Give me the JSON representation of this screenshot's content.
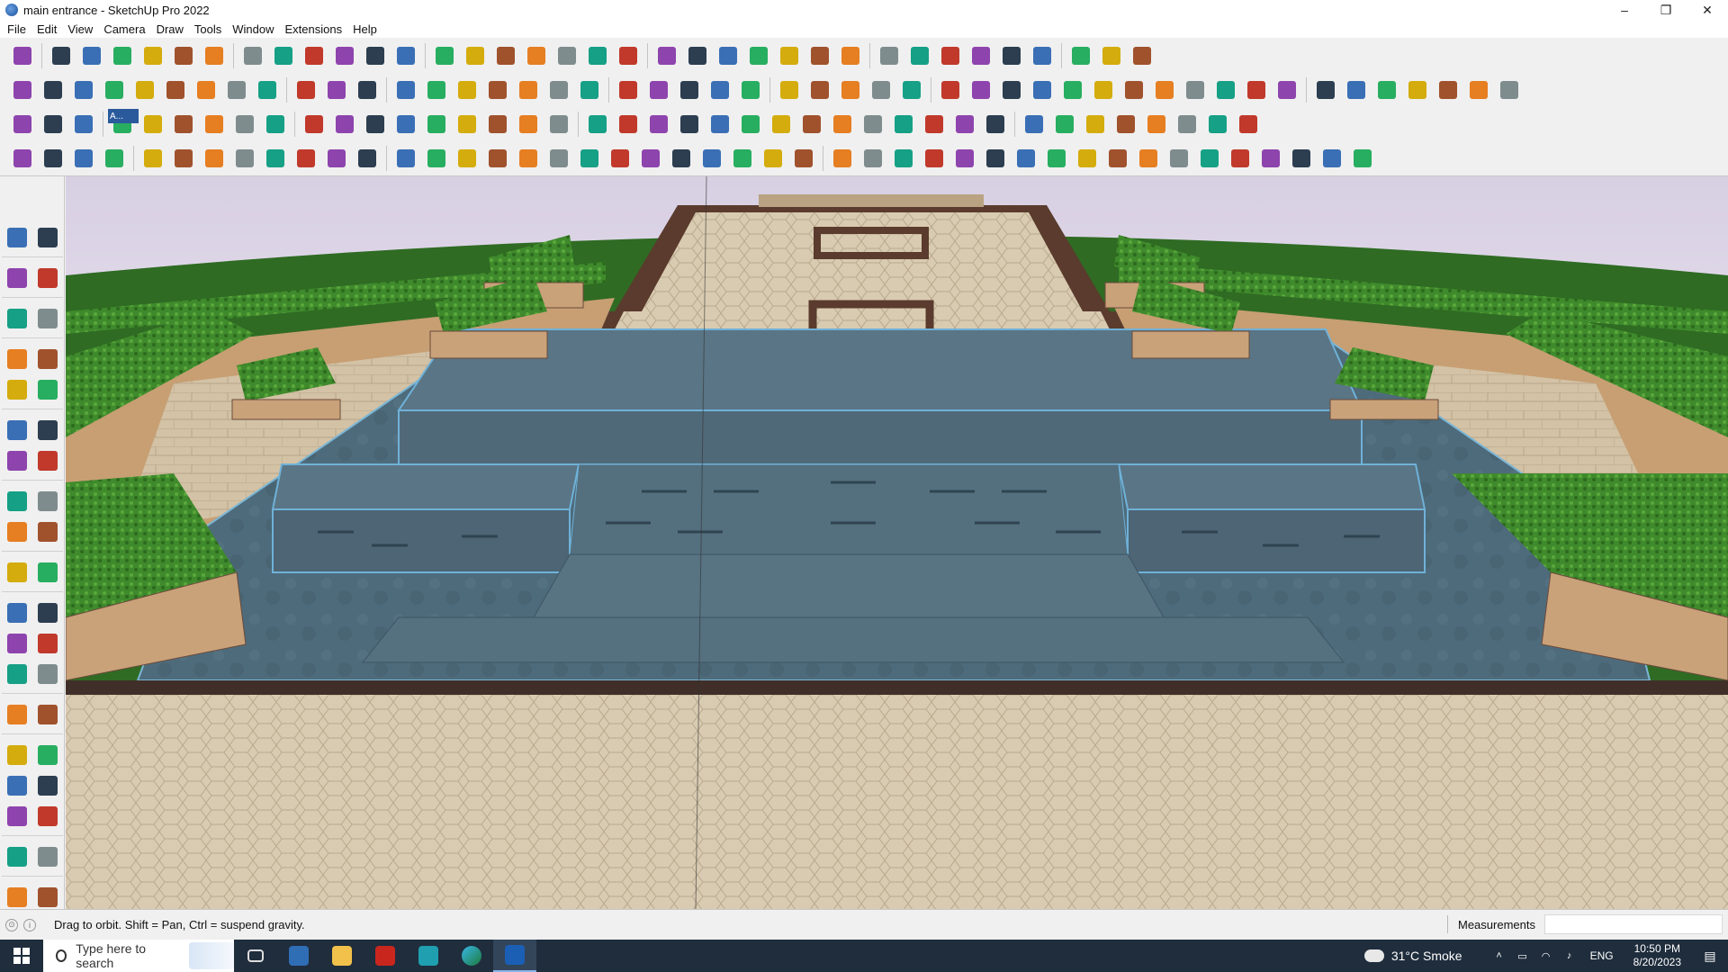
{
  "window": {
    "title": "main entrance - SketchUp Pro 2022",
    "minimize": "–",
    "restore": "❐",
    "close": "✕"
  },
  "menu": [
    "File",
    "Edit",
    "View",
    "Camera",
    "Draw",
    "Tools",
    "Window",
    "Extensions",
    "Help"
  ],
  "toolbar_tooltip": "A...",
  "status": {
    "hint": "Drag to orbit. Shift = Pan, Ctrl = suspend gravity.",
    "measurements_label": "Measurements",
    "measurements_value": ""
  },
  "taskbar": {
    "search_placeholder": "Type here to search",
    "weather": "31°C  Smoke",
    "language": "ENG",
    "time": "10:50 PM",
    "date": "8/20/2023"
  },
  "colors": {
    "sky": "#dcd3e6",
    "grass": "#2f6b23",
    "hedge": "#3c8a2a",
    "water": "#4d6a7a",
    "paving": "#d9cbb1",
    "planter": "#c9a27a",
    "border": "#6b4a3a"
  }
}
